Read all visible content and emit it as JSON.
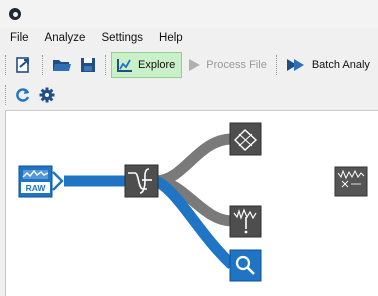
{
  "menu": {
    "items": [
      "File",
      "Analyze",
      "Settings",
      "Help"
    ]
  },
  "toolbar": {
    "explore_label": "Explore",
    "process_file_label": "Process File",
    "batch_label": "Batch Analy"
  },
  "canvas": {
    "raw_node_label": "RAW"
  },
  "colors": {
    "accent_blue": "#1f74c4",
    "pipe_gray": "#7a7a7a",
    "node_dark": "#4e4e4e",
    "explore_bg": "#c9f0c9"
  },
  "icons": {
    "toolbar1": [
      "export-icon",
      "open-folder-icon",
      "save-icon",
      "explore-icon",
      "play-icon",
      "batch-icon"
    ],
    "toolbar2": [
      "refresh-icon",
      "gear-icon"
    ],
    "nodes": [
      "raw-data-icon",
      "filter-icon",
      "transform-icon",
      "peaks-icon",
      "search-icon",
      "spectrum-icon"
    ]
  }
}
